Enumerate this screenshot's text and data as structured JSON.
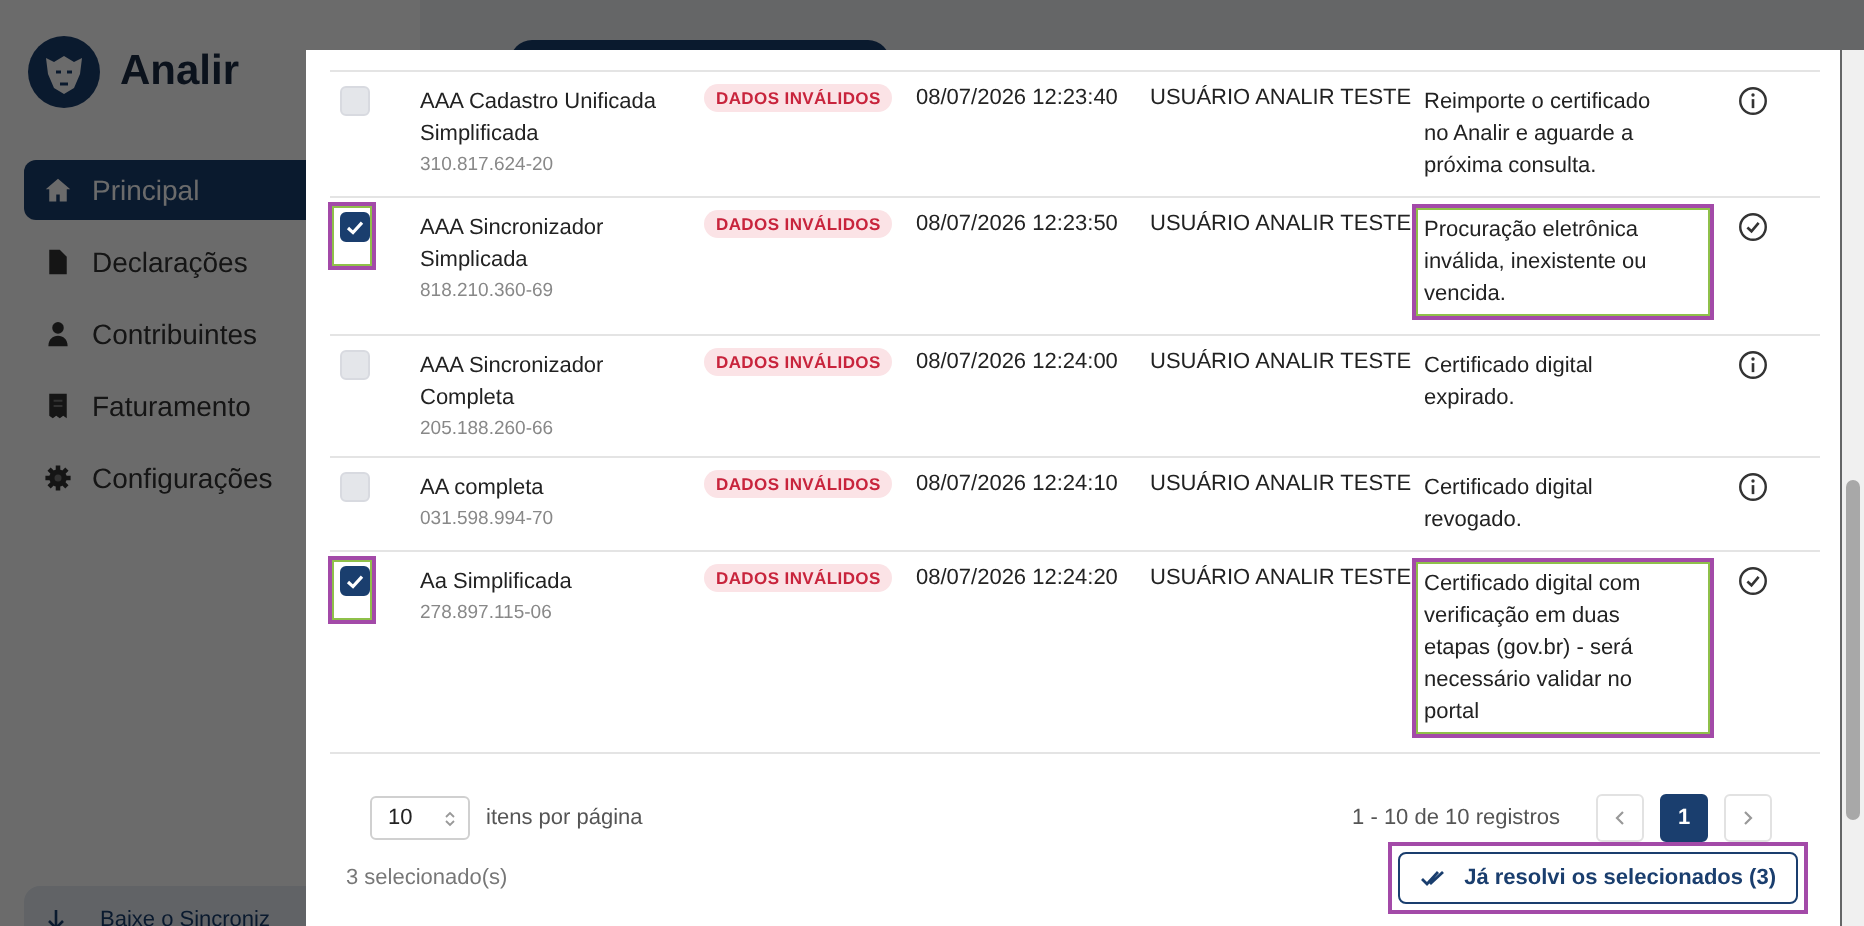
{
  "sidebar": {
    "brand": "Analir",
    "items": [
      {
        "label": "Principal",
        "selected": true
      },
      {
        "label": "Declarações",
        "selected": false
      },
      {
        "label": "Contribuintes",
        "selected": false
      },
      {
        "label": "Faturamento",
        "selected": false
      },
      {
        "label": "Configurações",
        "selected": false
      }
    ],
    "download_button": "Baixe o Sincroniz"
  },
  "modal": {
    "rows": [
      {
        "name": "AAA Cadastro Unificada Simplificada",
        "document": "310.817.624-20",
        "status": "DADOS INVÁLIDOS",
        "datetime": "08/07/2026 12:23:40",
        "user": "USUÁRIO ANALIR TESTE",
        "message": "Reimporte o certificado no Analir e aguarde a próxima consulta.",
        "checked": false,
        "highlighted": false,
        "kind": "info"
      },
      {
        "name": "AAA Sincronizador Simplicada",
        "document": "818.210.360-69",
        "status": "DADOS INVÁLIDOS",
        "datetime": "08/07/2026 12:23:50",
        "user": "USUÁRIO ANALIR TESTE",
        "message": "Procuração eletrônica inválida, inexistente ou vencida.",
        "checked": true,
        "highlighted": true,
        "kind": "resolve"
      },
      {
        "name": "AAA Sincronizador Completa",
        "document": "205.188.260-66",
        "status": "DADOS INVÁLIDOS",
        "datetime": "08/07/2026 12:24:00",
        "user": "USUÁRIO ANALIR TESTE",
        "message": "Certificado digital expirado.",
        "checked": false,
        "highlighted": false,
        "kind": "info"
      },
      {
        "name": "AA completa",
        "document": "031.598.994-70",
        "status": "DADOS INVÁLIDOS",
        "datetime": "08/07/2026 12:24:10",
        "user": "USUÁRIO ANALIR TESTE",
        "message": "Certificado digital revogado.",
        "checked": false,
        "highlighted": false,
        "kind": "info"
      },
      {
        "name": "Aa Simplificada",
        "document": "278.897.115-06",
        "status": "DADOS INVÁLIDOS",
        "datetime": "08/07/2026 12:24:20",
        "user": "USUÁRIO ANALIR TESTE",
        "message": "Certificado digital com verificação em duas etapas (gov.br) - será necessário validar no portal",
        "checked": true,
        "highlighted": true,
        "kind": "resolve"
      }
    ],
    "pagination": {
      "page_size": "10",
      "page_size_label": "itens por página",
      "summary": "1 - 10 de 10 registros",
      "pages": [
        {
          "label": "1",
          "selected": true
        }
      ]
    },
    "selected_count": "3 selecionado(s)",
    "resolve_button": {
      "label": "Já resolvi os selecionados (3)",
      "highlighted": true
    }
  }
}
